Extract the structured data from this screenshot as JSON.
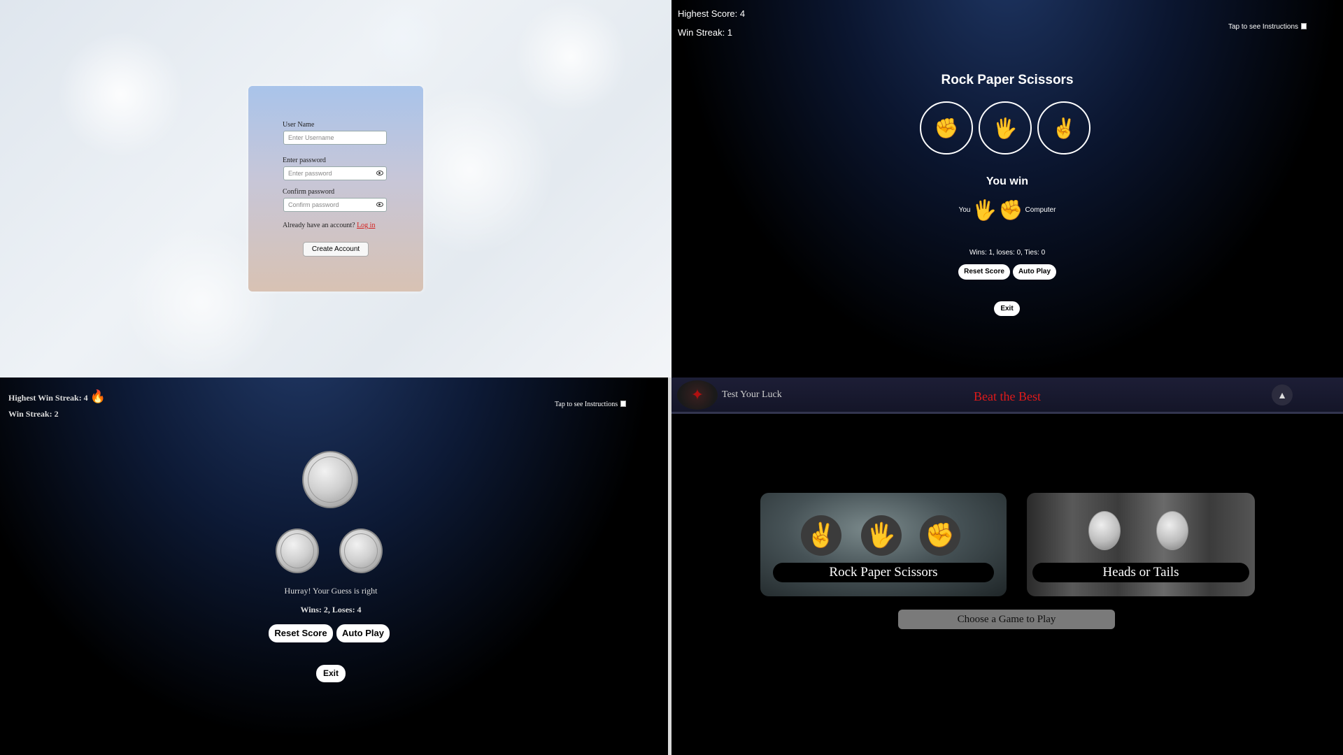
{
  "signup": {
    "username_label": "User Name",
    "username_placeholder": "Enter Username",
    "password_label": "Enter password",
    "password_placeholder": "Enter password",
    "confirm_label": "Confirm password",
    "confirm_placeholder": "Confirm password",
    "have_account_text": "Already have an account?",
    "login_link": "Log in",
    "create_button": "Create Account"
  },
  "rps": {
    "highest_score": "Highest Score: 4",
    "win_streak": "Win Streak: 1",
    "instructions": "Tap to see Instructions",
    "title": "Rock Paper Scissors",
    "choices": [
      "✊",
      "🖐",
      "✌"
    ],
    "result": "You win",
    "you_label": "You",
    "you_move": "🖐",
    "computer_move": "✊",
    "computer_label": "Computer",
    "score": "Wins: 1, loses: 0, Ties: 0",
    "reset_button": "Reset Score",
    "auto_button": "Auto Play",
    "exit_button": "Exit"
  },
  "coin": {
    "highest_win_streak": "Highest Win Streak: 4",
    "fire_icon": "🔥",
    "win_streak": "Win Streak: 2",
    "instructions": "Tap to see Instructions",
    "message": "Hurray! Your Guess is right",
    "score": "Wins: 2, Loses: 4",
    "reset_button": "Reset Score",
    "auto_button": "Auto Play",
    "exit_button": "Exit"
  },
  "home": {
    "nav_left": "Test Your Luck",
    "brand": "Beat the Best",
    "games": [
      {
        "label": "Rock Paper Scissors",
        "icons": [
          "✌",
          "🖐",
          "✊"
        ]
      },
      {
        "label": "Heads or Tails"
      }
    ],
    "choose_text": "Choose a Game to Play"
  },
  "colors": {
    "link_red": "#d42020",
    "brand_red": "#e01a1a"
  }
}
